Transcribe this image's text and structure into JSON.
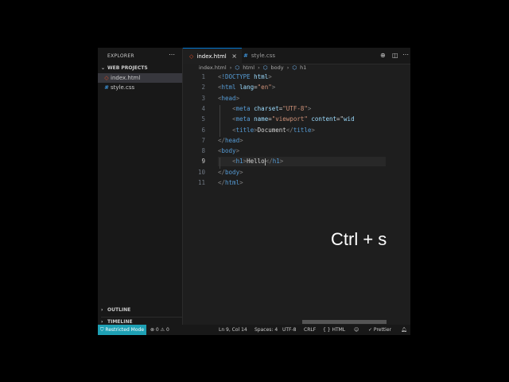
{
  "sidebar": {
    "title": "EXPLORER",
    "more_icon": "more-icon",
    "folder": "WEB PROJECTS",
    "files": [
      {
        "name": "index.html",
        "icon": "html-file-icon",
        "color": "#e44d26"
      },
      {
        "name": "style.css",
        "icon": "css-file-icon",
        "color": "#42a5f5"
      }
    ],
    "outline": "OUTLINE",
    "timeline": "TIMELINE"
  },
  "tabs": [
    {
      "label": "index.html",
      "icon": "html-file-icon",
      "color": "#e44d26",
      "close": "×"
    },
    {
      "label": "style.css",
      "icon": "css-file-icon",
      "color": "#42a5f5"
    }
  ],
  "breadcrumb": [
    "index.html",
    "html",
    "body",
    "h1"
  ],
  "code": {
    "line_numbers": [
      "1",
      "2",
      "3",
      "4",
      "5",
      "6",
      "7",
      "8",
      "9",
      "10",
      "11"
    ],
    "lines": [
      "<!DOCTYPE html>",
      "<html lang=\"en\">",
      "<head>",
      "    <meta charset=\"UTF-8\">",
      "    <meta name=\"viewport\" content=\"wid",
      "    <title>Document</title>",
      "</head>",
      "<body>",
      "    <h1>Hello</h1>",
      "</body>",
      "</html>"
    ],
    "active_line": 9
  },
  "overlay": {
    "text": "Ctrl + s"
  },
  "status": {
    "restricted": "Restricted Mode",
    "problems": "⊗ 0 ⚠ 0",
    "position": "Ln 9, Col 14",
    "spaces": "Spaces: 4",
    "encoding": "UTF-8",
    "eol": "CRLF",
    "language": "{ } HTML",
    "prettier": "✓ Prettier"
  },
  "colors": {
    "accent": "#0078d4",
    "restricted_bg": "#1ea0b4",
    "editor_bg": "#1e1e1e"
  }
}
